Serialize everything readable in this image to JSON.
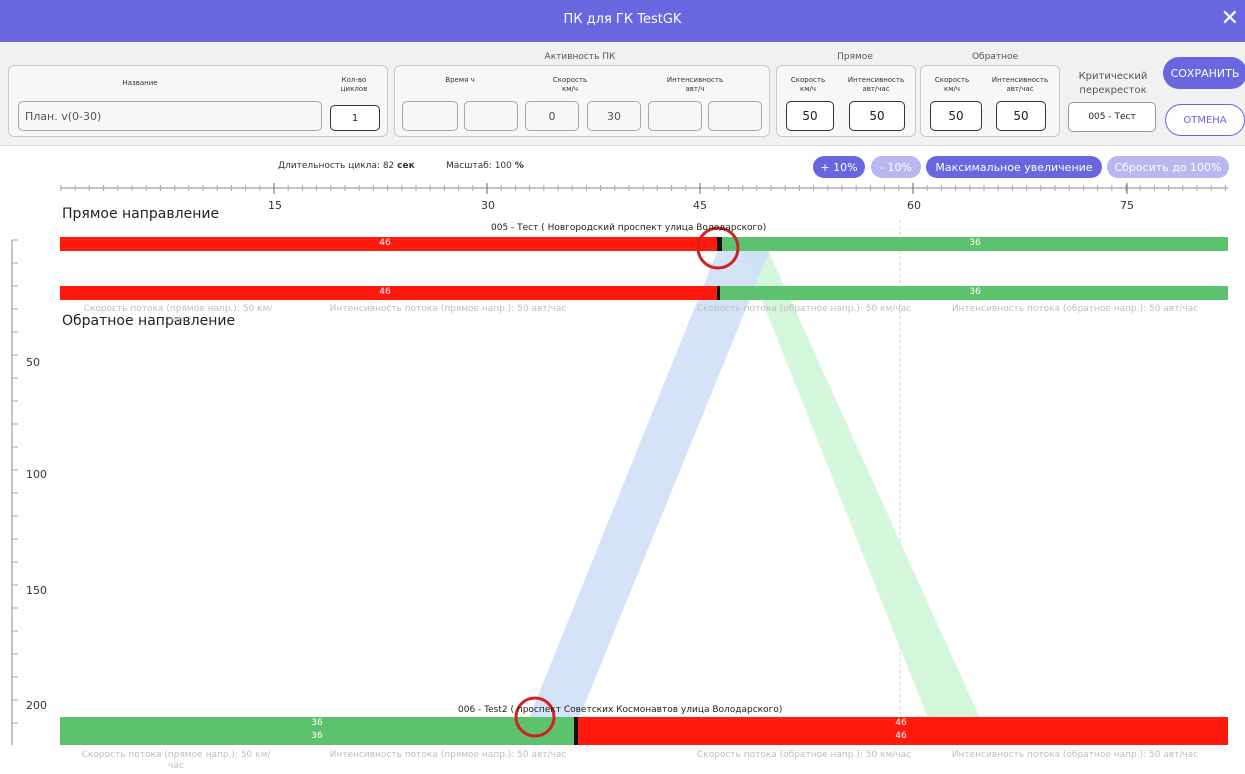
{
  "window": {
    "title": "ПК для ГК TestGK"
  },
  "header": {
    "name_group": {
      "col_name": "Название",
      "col_cycles": "Кол-во циклов",
      "plan_value": "План. v(0-30)",
      "cycles_value": "1"
    },
    "activity": {
      "group_title": "Активность ПК",
      "time_label": "Время ч",
      "speed_label": "Скорость км/ч",
      "intensity_label": "Интенсивность авт/ч",
      "speed_from": "0",
      "speed_to": "30"
    },
    "forward": {
      "group_title": "Прямое",
      "speed_label": "Скорость км/ч",
      "intensity_label": "Интенсивность авт/час",
      "speed": "50",
      "intensity": "50"
    },
    "reverse": {
      "group_title": "Обратное",
      "speed_label": "Скорость км/ч",
      "intensity_label": "Интенсивность авт/час",
      "speed": "50",
      "intensity": "50"
    },
    "critical": {
      "label": "Критический перекресток",
      "value": "005 - Тест"
    },
    "save_label": "СОХРАНИТЬ",
    "cancel_label": "ОТМЕНА"
  },
  "toolbar": {
    "cycle_label": "Длительность цикла:",
    "cycle_value": "82",
    "cycle_unit": "сек",
    "scale_label": "Масштаб:",
    "scale_value": "100",
    "scale_unit": "%",
    "zoom_in": "+ 10%",
    "zoom_out": "- 10%",
    "zoom_max": "Максимальное увеличение",
    "zoom_reset": "Сбросить до 100%"
  },
  "diagram": {
    "x_ticks": [
      "15",
      "30",
      "45",
      "60",
      "75"
    ],
    "y_ticks": [
      "50",
      "100",
      "150",
      "200"
    ],
    "forward_title": "Прямое направление",
    "reverse_title": "Обратное направление",
    "intersection_1": "005 - Тест ( Новгородский проспект улица Володарского)",
    "intersection_2": "006 - Test2 ( проспект Советских Космонавтов улица Володарского)",
    "red_value": "46",
    "green_value": "36",
    "flow_fwd_speed": "Скорость потока (прямое напр.): 50 км/час",
    "flow_fwd_int": "Интенсивность потока (прямое напр.): 50 авт/час",
    "flow_rev_speed": "Скорость потока (обратное напр.): 50 км/час",
    "flow_rev_int": "Интенсивность потока (обратное напр.): 50 авт/час",
    "colors": {
      "red": "#ff1a0d",
      "green": "#5cc26e",
      "blue_band": "#cfe0f7",
      "green_band": "#d2f5d9",
      "accent": "#6a66e0"
    }
  }
}
